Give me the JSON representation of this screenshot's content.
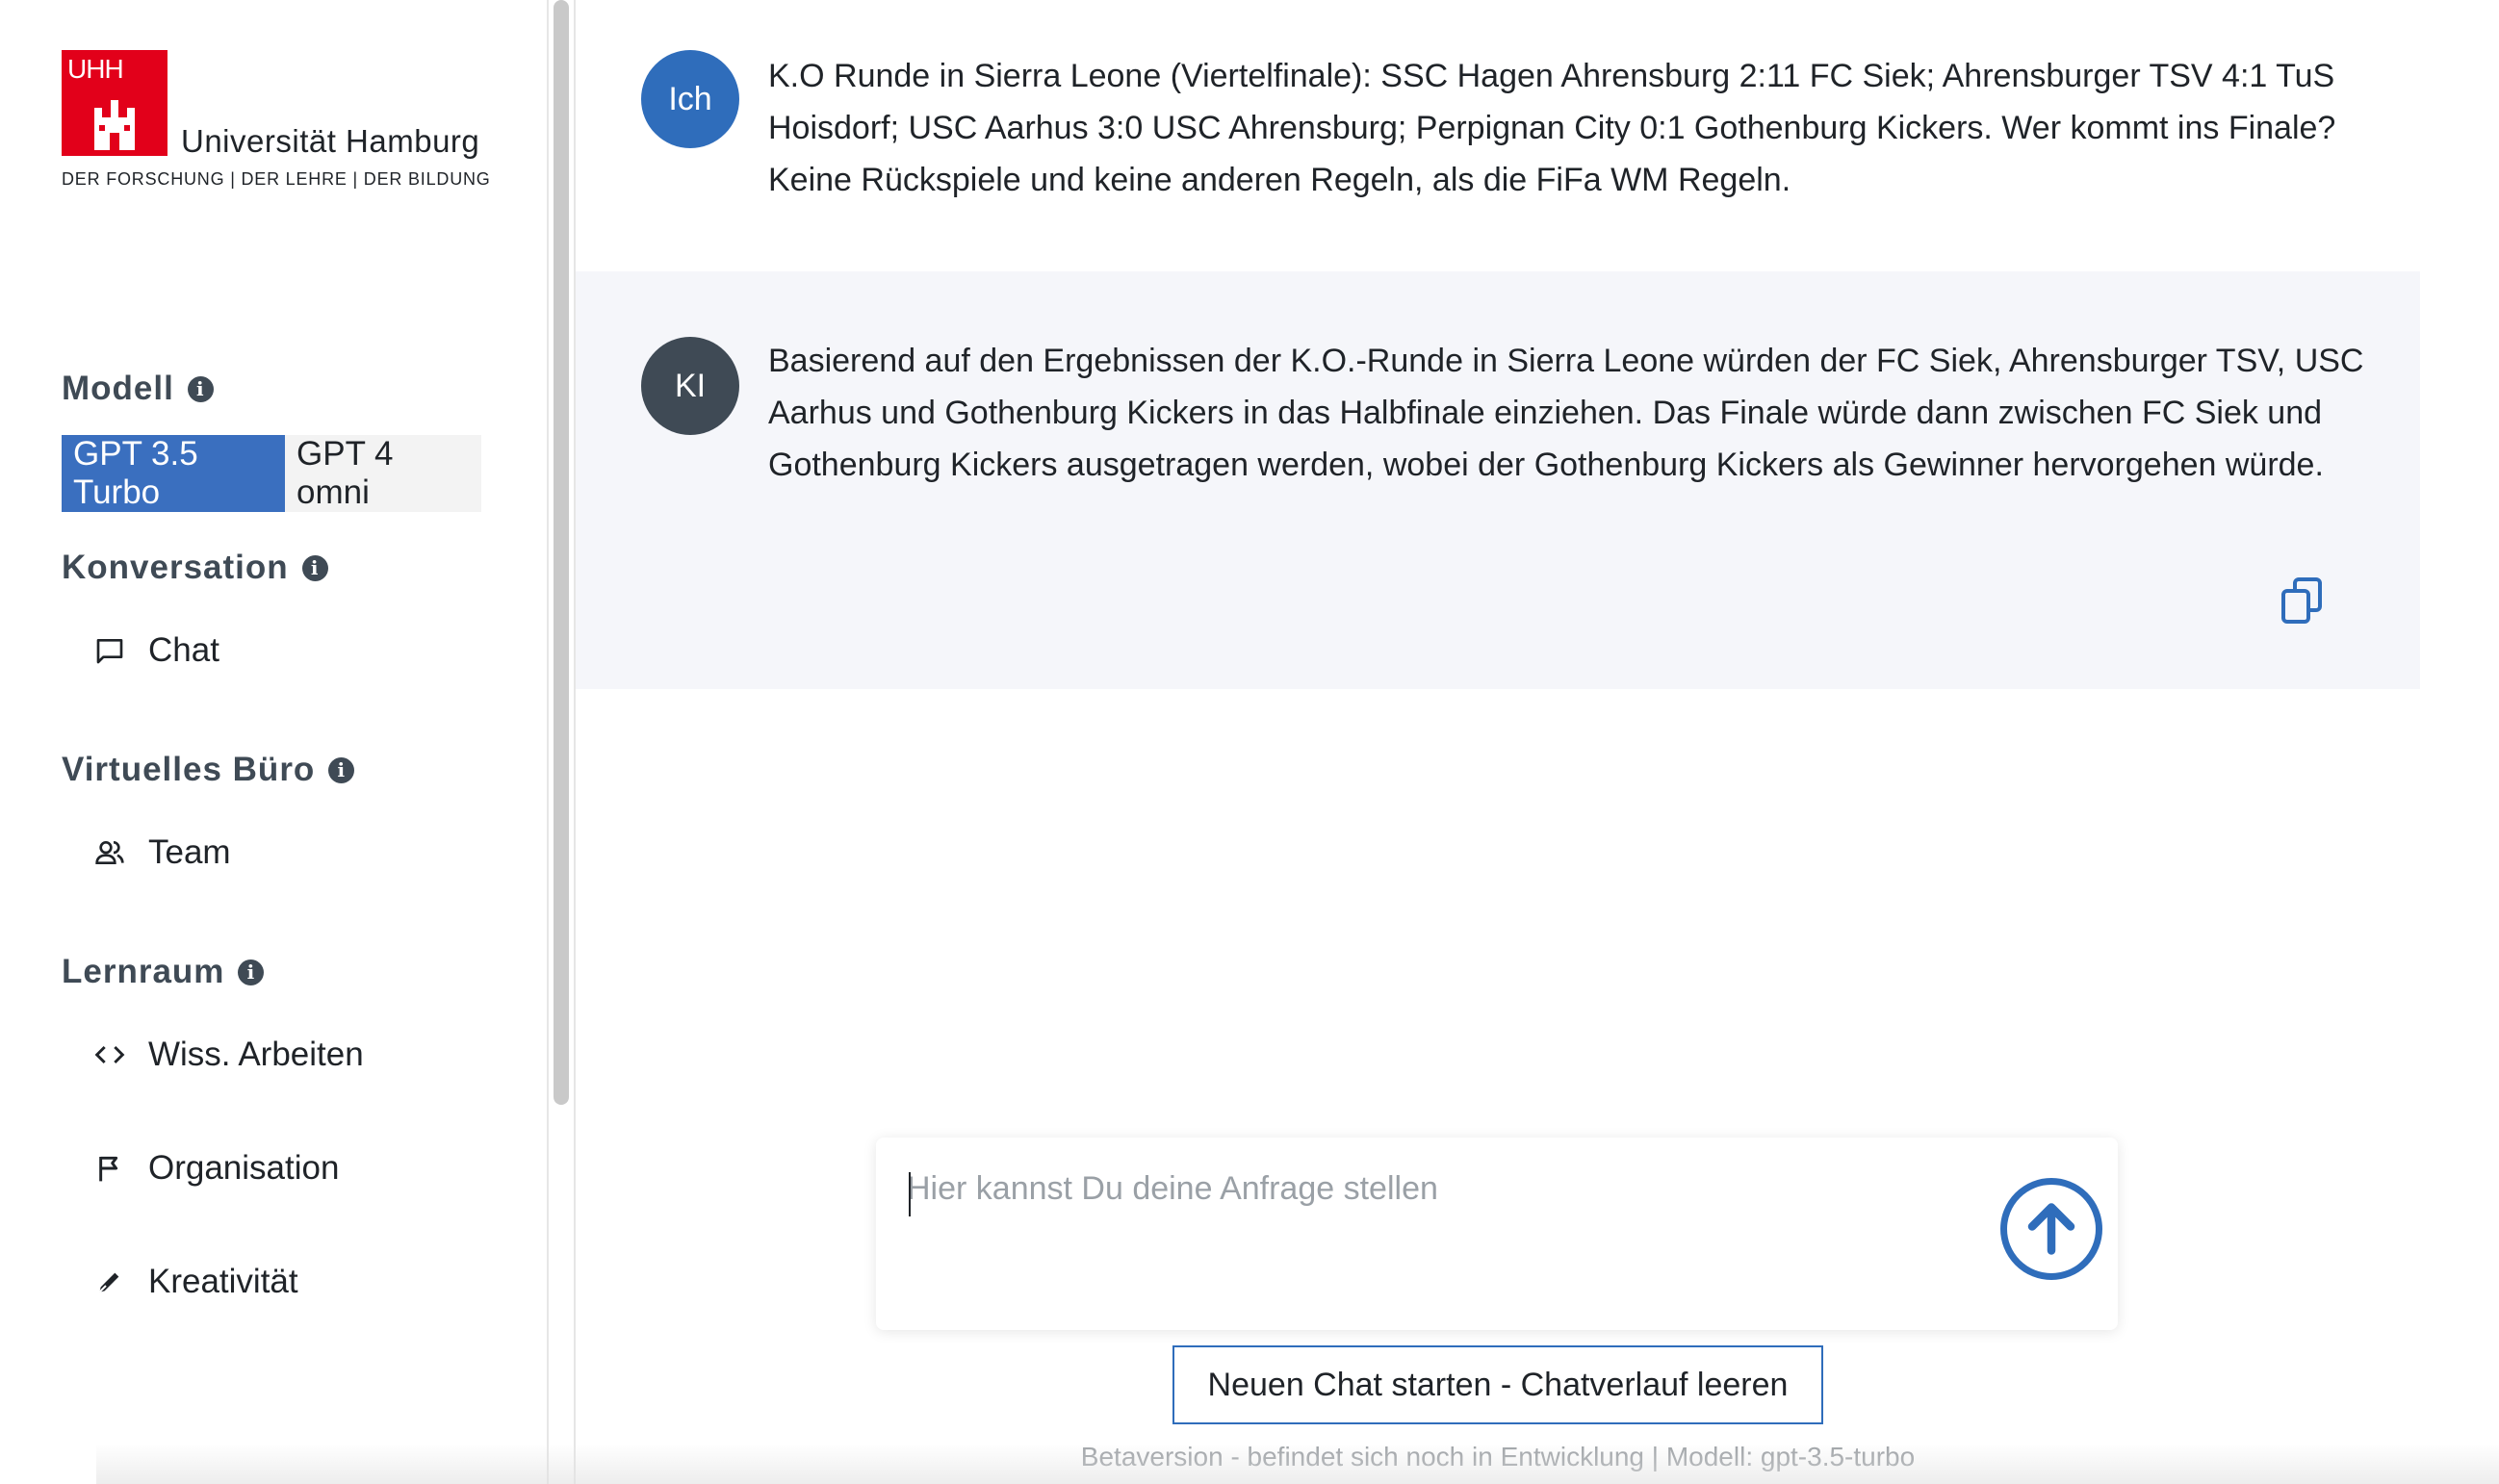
{
  "logo": {
    "mark_text": "UHH",
    "name": "Universität Hamburg",
    "subtitle": "DER FORSCHUNG | DER LEHRE | DER BILDUNG"
  },
  "sidebar": {
    "model": {
      "title": "Modell",
      "options": [
        "GPT 3.5 Turbo",
        "GPT 4 omni"
      ],
      "selected": "GPT 3.5 Turbo"
    },
    "conversation": {
      "title": "Konversation",
      "items": [
        {
          "label": "Chat",
          "icon": "chat-bubble-icon"
        }
      ]
    },
    "office": {
      "title": "Virtuelles Büro",
      "items": [
        {
          "label": "Team",
          "icon": "people-icon"
        }
      ]
    },
    "learning": {
      "title": "Lernraum",
      "items": [
        {
          "label": "Wiss. Arbeiten",
          "icon": "code-icon"
        },
        {
          "label": "Organisation",
          "icon": "flag-icon"
        },
        {
          "label": "Kreativität",
          "icon": "pen-icon"
        }
      ]
    }
  },
  "messages": [
    {
      "role": "user",
      "avatar": "Ich",
      "text": "K.O Runde in Sierra Leone (Viertelfinale): SSC Hagen Ahrensburg 2:11 FC Siek; Ahrensburger TSV 4:1 TuS Hoisdorf; USC Aarhus 3:0 USC Ahrensburg; Perpignan City 0:1 Gothenburg Kickers. Wer kommt ins Finale? Keine Rückspiele und keine anderen Regeln, als die FiFa WM Regeln."
    },
    {
      "role": "ai",
      "avatar": "KI",
      "text": "Basierend auf den Ergebnissen der K.O.-Runde in Sierra Leone würden der FC Siek, Ahrensburger TSV, USC Aarhus und Gothenburg Kickers in das Halbfinale einziehen. Das Finale würde dann zwischen FC Siek und Gothenburg Kickers ausgetragen werden, wobei der Gothenburg Kickers als Gewinner hervorgehen würde."
    }
  ],
  "input": {
    "placeholder": "Hier kannst Du deine Anfrage stellen",
    "value": ""
  },
  "new_chat_label": "Neuen Chat starten - Chatverlauf leeren",
  "footer": "Betaversion - befindet sich noch in Entwicklung | Modell: gpt-3.5-turbo",
  "colors": {
    "accent": "#2f6dbb",
    "brand_red": "#e2001a",
    "ai_bg": "#f5f6fa"
  }
}
